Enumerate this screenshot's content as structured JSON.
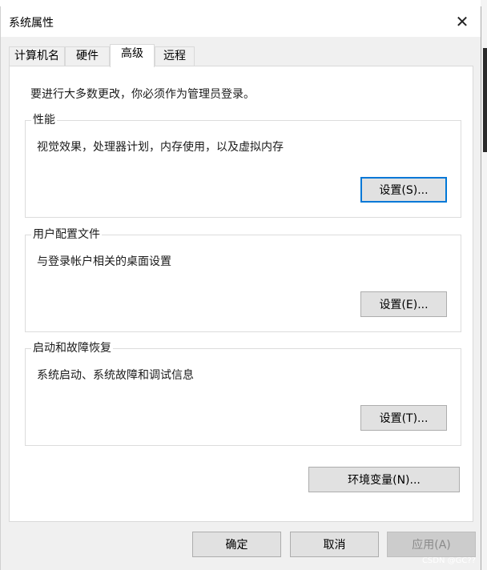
{
  "window": {
    "title": "系统属性",
    "close_glyph": "✕"
  },
  "tabs": [
    {
      "label": "计算机名",
      "active": false
    },
    {
      "label": "硬件",
      "active": false
    },
    {
      "label": "高级",
      "active": true
    },
    {
      "label": "远程",
      "active": false
    }
  ],
  "admin_note": "要进行大多数更改，你必须作为管理员登录。",
  "performance": {
    "title": "性能",
    "description": "视觉效果，处理器计划，内存使用，以及虚拟内存",
    "button": "设置(S)..."
  },
  "user_profiles": {
    "title": "用户配置文件",
    "description": "与登录帐户相关的桌面设置",
    "button": "设置(E)..."
  },
  "startup_recovery": {
    "title": "启动和故障恢复",
    "description": "系统启动、系统故障和调试信息",
    "button": "设置(T)..."
  },
  "env_button": "环境变量(N)...",
  "footer": {
    "ok": "确定",
    "cancel": "取消",
    "apply": "应用(A)"
  },
  "watermark": "CSDN @GC??",
  "colors": {
    "focus": "#0078d7",
    "dialog_bg": "#f0f0f0",
    "panel_bg": "#ffffff"
  }
}
